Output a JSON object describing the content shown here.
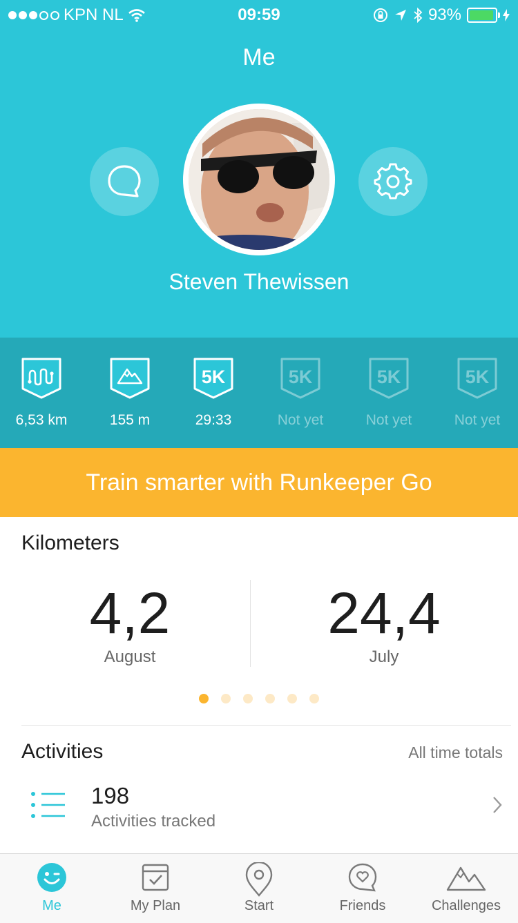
{
  "status_bar": {
    "carrier": "KPN NL",
    "time": "09:59",
    "battery": "93%",
    "battery_level": 0.93
  },
  "header": {
    "title": "Me",
    "user_name": "Steven Thewissen"
  },
  "achievements": [
    {
      "icon": "route-badge-icon",
      "label": "6,53 km",
      "earned": true
    },
    {
      "icon": "mountain-badge-icon",
      "label": "155 m",
      "earned": true
    },
    {
      "icon": "5k-badge-icon",
      "badge_text": "5K",
      "label": "29:33",
      "earned": true
    },
    {
      "icon": "5k-badge-icon",
      "badge_text": "5K",
      "label": "Not yet",
      "earned": false
    },
    {
      "icon": "5k-badge-icon",
      "badge_text": "5K",
      "label": "Not yet",
      "earned": false
    },
    {
      "icon": "5k-badge-icon",
      "badge_text": "5K",
      "label": "Not yet",
      "earned": false
    }
  ],
  "banner": {
    "text": "Train smarter with Runkeeper Go"
  },
  "kilometers": {
    "title": "Kilometers",
    "current": {
      "value": "4,2",
      "label": "August"
    },
    "previous": {
      "value": "24,4",
      "label": "July"
    },
    "pages": 6,
    "active_page": 1
  },
  "activities": {
    "title": "Activities",
    "totals_label": "All time totals",
    "count": "198",
    "count_label": "Activities tracked"
  },
  "tabs": [
    {
      "name": "tab-me",
      "label": "Me",
      "active": true
    },
    {
      "name": "tab-my-plan",
      "label": "My Plan",
      "active": false
    },
    {
      "name": "tab-start",
      "label": "Start",
      "active": false
    },
    {
      "name": "tab-friends",
      "label": "Friends",
      "active": false
    },
    {
      "name": "tab-challenges",
      "label": "Challenges",
      "active": false
    }
  ],
  "colors": {
    "primary": "#2cc6d8",
    "achievements_bg": "#25a9b8",
    "banner": "#fbb52f",
    "text": "#1e1e1e"
  }
}
